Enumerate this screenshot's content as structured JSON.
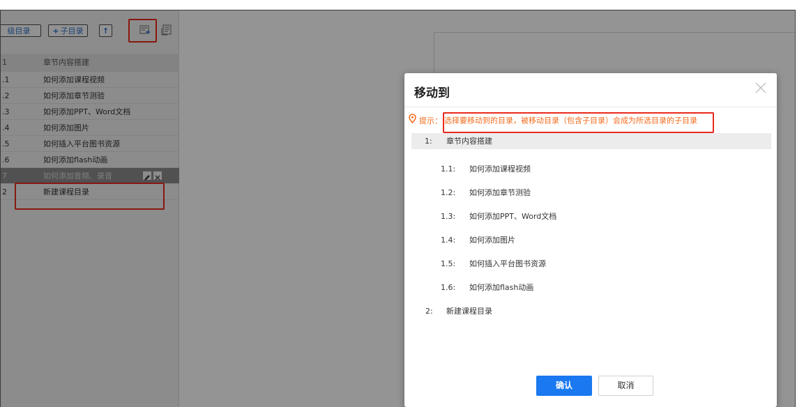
{
  "toolbar": {
    "add_sibling_label": "级目录",
    "add_child_label": "子目录",
    "add_child_prefix": "+",
    "move_up_glyph": "↑",
    "icons": [
      "move-to-icon",
      "batch-icon"
    ]
  },
  "chapter_list": [
    {
      "num": "1",
      "label": "章节内容搭建"
    },
    {
      "num": ".1",
      "label": "如何添加课程视频"
    },
    {
      "num": ".2",
      "label": "如何添加章节测验"
    },
    {
      "num": ".3",
      "label": "如何添加PPT、Word文档"
    },
    {
      "num": ".4",
      "label": "如何添加图片"
    },
    {
      "num": ".5",
      "label": "如何插入平台图书资源"
    },
    {
      "num": ".6",
      "label": "如何添加flash动画"
    },
    {
      "num": "7",
      "label": "如何添加音频、录音"
    },
    {
      "num": "2",
      "label": "新建课程目录"
    }
  ],
  "dialog": {
    "title": "移动到",
    "tip_label": "提示：",
    "tip_text": "选择要移动到的目录，被移动目录（包含子目录）会成为所选目录的子目录",
    "options": [
      {
        "num": "1:",
        "label": "章节内容搭建"
      },
      {
        "num": "1.1:",
        "label": "如何添加课程视频"
      },
      {
        "num": "1.2:",
        "label": "如何添加章节测验"
      },
      {
        "num": "1.3:",
        "label": "如何添加PPT、Word文档"
      },
      {
        "num": "1.4:",
        "label": "如何添加图片"
      },
      {
        "num": "1.5:",
        "label": "如何插入平台图书资源"
      },
      {
        "num": "1.6:",
        "label": "如何添加flash动画"
      },
      {
        "num": "2:",
        "label": "新建课程目录"
      }
    ],
    "confirm_label": "确认",
    "cancel_label": "取消"
  },
  "colors": {
    "primary": "#1a78f0",
    "tip": "#f36b1c",
    "highlight": "#e8291c"
  }
}
